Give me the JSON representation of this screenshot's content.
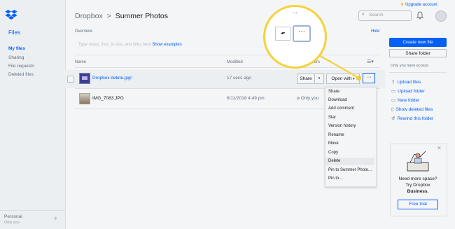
{
  "sidebar": {
    "title": "Files",
    "items": [
      {
        "label": "My files",
        "active": true
      },
      {
        "label": "Sharing"
      },
      {
        "label": "File requests"
      },
      {
        "label": "Deleted files"
      }
    ],
    "footer": {
      "name": "Personal",
      "sub": "Only you"
    }
  },
  "header": {
    "breadcrumb_root": "Dropbox",
    "breadcrumb_sep": ">",
    "breadcrumb_current": "Summer Photos",
    "upgrade": "Upgrade account",
    "search_placeholder": "Search"
  },
  "overview": {
    "label": "Overview",
    "hide": "Hide",
    "hint": "Type notes, lists, to-dos, and links here",
    "hint_link": "Show examples"
  },
  "right_panel": {
    "create_button": "Create new file",
    "share_folder_button": "Share folder",
    "access_note": "Only you have access",
    "actions": [
      {
        "icon": "upload-files-icon",
        "label": "Upload files"
      },
      {
        "icon": "upload-folder-icon",
        "label": "Upload folder"
      },
      {
        "icon": "new-folder-icon",
        "label": "New folder"
      },
      {
        "icon": "show-deleted-icon",
        "label": "Show deleted files"
      },
      {
        "icon": "rewind-icon",
        "label": "Rewind this folder"
      }
    ],
    "promo": {
      "line1": "Need more space?",
      "line2": "Try Dropbox",
      "line3": "Business.",
      "button": "Free trial"
    }
  },
  "table": {
    "columns": {
      "name": "Name",
      "modified": "Modified",
      "members": "Members"
    },
    "rows": [
      {
        "name": "Dropbox delete.jpg",
        "modified": "17 secs ago",
        "share": "Share",
        "open_with": "Open with",
        "more": "···"
      },
      {
        "name": "IMG_7083.JPG",
        "modified": "6/11/2018 4:49 pm",
        "members": "Only you"
      }
    ]
  },
  "context_menu": {
    "items": [
      "Share",
      "Download",
      "Add comment",
      "Star",
      "Version history",
      "Rename",
      "Move",
      "Copy",
      "Delete",
      "Pin to Summer Photo...",
      "Pin to..."
    ],
    "highlighted": "Delete"
  },
  "colors": {
    "accent": "#0061fe",
    "callout": "#f4d33a"
  }
}
